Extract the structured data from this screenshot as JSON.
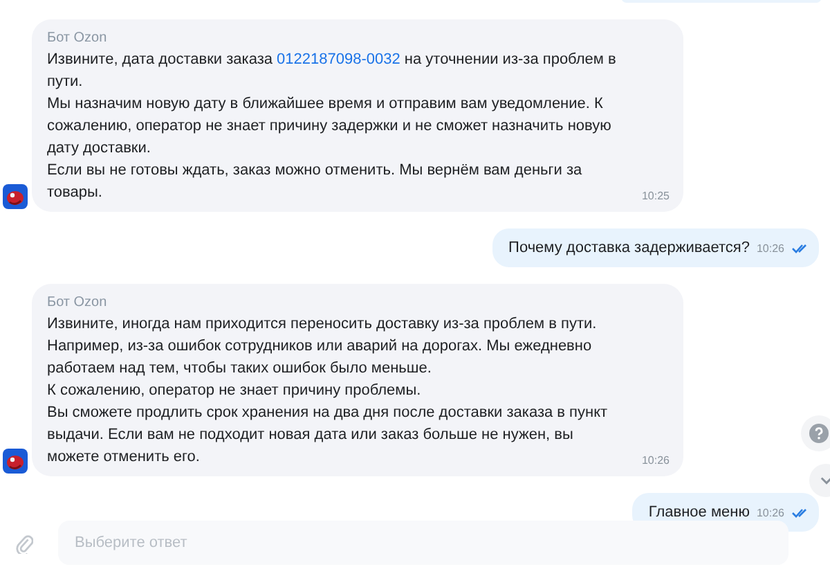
{
  "messages": [
    {
      "kind": "bot",
      "sender": "Бот Ozon",
      "paragraphs": [
        [
          {
            "kind": "text",
            "text": "Извините, дата доставки заказа "
          },
          {
            "kind": "link",
            "text": "0122187098-0032"
          },
          {
            "kind": "text",
            "text": " на уточнении из-за проблем в пути."
          }
        ],
        [
          {
            "kind": "text",
            "text": "Мы назначим новую дату в ближайшее время и отправим вам уведомление. К сожалению, оператор не знает причину задержки и не сможет назначить новую дату доставки."
          }
        ],
        [
          {
            "kind": "text",
            "text": "Если вы не готовы ждать, заказ можно отменить. Мы вернём вам деньги за товары."
          }
        ]
      ],
      "time": "10:25"
    },
    {
      "kind": "user",
      "text": "Почему доставка задерживается?",
      "time": "10:26",
      "read": true
    },
    {
      "kind": "bot",
      "sender": "Бот Ozon",
      "paragraphs": [
        [
          {
            "kind": "text",
            "text": "Извините, иногда нам приходится переносить доставку из-за проблем в пути. Например, из-за ошибок сотрудников или аварий на дорогах. Мы ежедневно работаем над тем, чтобы таких ошибок было меньше."
          }
        ],
        [
          {
            "kind": "text",
            "text": "К сожалению, оператор не знает причину проблемы."
          }
        ],
        [
          {
            "kind": "text",
            "text": "Вы сможете продлить срок хранения на два дня после доставки заказа в пункт выдачи. Если вам не подходит новая дата или заказ больше не нужен, вы можете отменить его."
          }
        ]
      ],
      "time": "10:26"
    },
    {
      "kind": "user",
      "text": "Главное меню",
      "time": "10:26",
      "read": true
    }
  ],
  "input": {
    "placeholder": "Выберите ответ"
  }
}
